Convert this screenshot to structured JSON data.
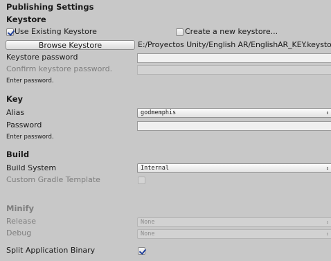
{
  "panel": {
    "title": "Publishing Settings"
  },
  "keystore": {
    "header": "Keystore",
    "use_existing_label": "Use Existing Keystore",
    "use_existing_checked": true,
    "create_new_label": "Create a new keystore...",
    "create_new_checked": false,
    "browse_button": "Browse Keystore",
    "path": "E:/Proyectos Unity/English AR/EnglishAR_KEY.keystore",
    "password_label": "Keystore password",
    "confirm_password_label": "Confirm keystore password.",
    "enter_password_hint": "Enter password."
  },
  "key": {
    "header": "Key",
    "alias_label": "Alias",
    "alias_value": "godmemphis",
    "password_label": "Password",
    "enter_password_hint": "Enter password."
  },
  "build": {
    "header": "Build",
    "build_system_label": "Build System",
    "build_system_value": "Internal",
    "custom_gradle_label": "Custom Gradle Template",
    "custom_gradle_checked": false
  },
  "minify": {
    "header": "Minify",
    "release_label": "Release",
    "release_value": "None",
    "debug_label": "Debug",
    "debug_value": "None"
  },
  "split_binary": {
    "label": "Split Application Binary",
    "checked": true
  },
  "icons": {
    "dropdown_arrow": "updown-arrow-icon",
    "checkbox": "checkmark-icon"
  }
}
